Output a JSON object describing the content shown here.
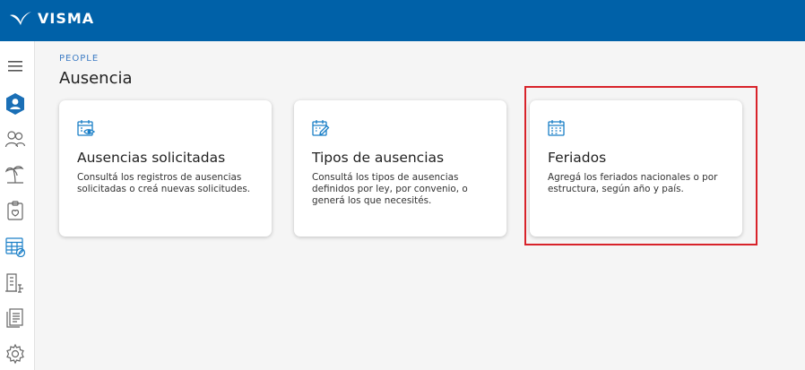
{
  "header": {
    "brand": "VISMA",
    "logo_icon": "visma-swoosh-icon",
    "background": "#0061a8"
  },
  "sidebar": {
    "items": [
      {
        "name": "menu",
        "icon": "hamburger-icon"
      },
      {
        "name": "people",
        "icon": "user-badge-icon",
        "active": true
      },
      {
        "name": "employees",
        "icon": "people-icon"
      },
      {
        "name": "vacations",
        "icon": "palm-tree-icon"
      },
      {
        "name": "health",
        "icon": "clipboard-icon"
      },
      {
        "name": "absences",
        "icon": "calendar-edit-icon"
      },
      {
        "name": "organization",
        "icon": "building-tree-icon"
      },
      {
        "name": "documents",
        "icon": "documents-icon"
      },
      {
        "name": "settings",
        "icon": "gear-icon"
      }
    ]
  },
  "breadcrumb": "PEOPLE",
  "page_title": "Ausencia",
  "cards": [
    {
      "icon": "calendar-eye-icon",
      "title": "Ausencias solicitadas",
      "description": "Consultá los registros de ausencias solicitadas o creá nuevas solicitudes."
    },
    {
      "icon": "calendar-pencil-icon",
      "title": "Tipos de ausencias",
      "description": "Consultá los tipos de ausencias definidos por ley, por convenio, o generá los que necesités."
    },
    {
      "icon": "calendar-grid-icon",
      "title": "Feriados",
      "description": "Agregá los feriados nacionales o por estructura, según año y país.",
      "highlighted": true
    }
  ],
  "colors": {
    "accent": "#1a7fc7",
    "highlight": "#d8232a"
  }
}
